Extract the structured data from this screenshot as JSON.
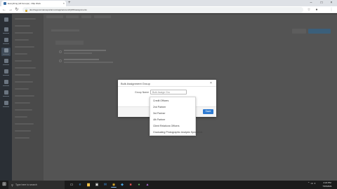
{
  "browser": {
    "tab_title": "Everything (All Groups) - Rbp Work",
    "tab_close": "×",
    "new_tab": "+",
    "url": "dev.thegovernanceportal.com/app/account/Q4W/assignments",
    "win_minimize": "–",
    "win_maximize": "□",
    "win_close": "×"
  },
  "modal": {
    "title": "Bulk Assignment Group",
    "close": "×",
    "field_label": "Group Name",
    "field_value": "Bulk Assign Gro",
    "save_label": "Save"
  },
  "dropdown": {
    "options": [
      "Credit Officers",
      "2nd Partner",
      "3rd Partner",
      "4th Partner",
      "Client Relations Officers",
      "Graduating Photographic Analysis Specialists"
    ]
  },
  "taskbar": {
    "search_placeholder": "Type here to search",
    "clock_time": "4:22 PM",
    "clock_date": "7/15/2021"
  },
  "colors": {
    "accent": "#2f7bd1",
    "overlay": "#575757",
    "taskbar": "#1b1b1b"
  }
}
